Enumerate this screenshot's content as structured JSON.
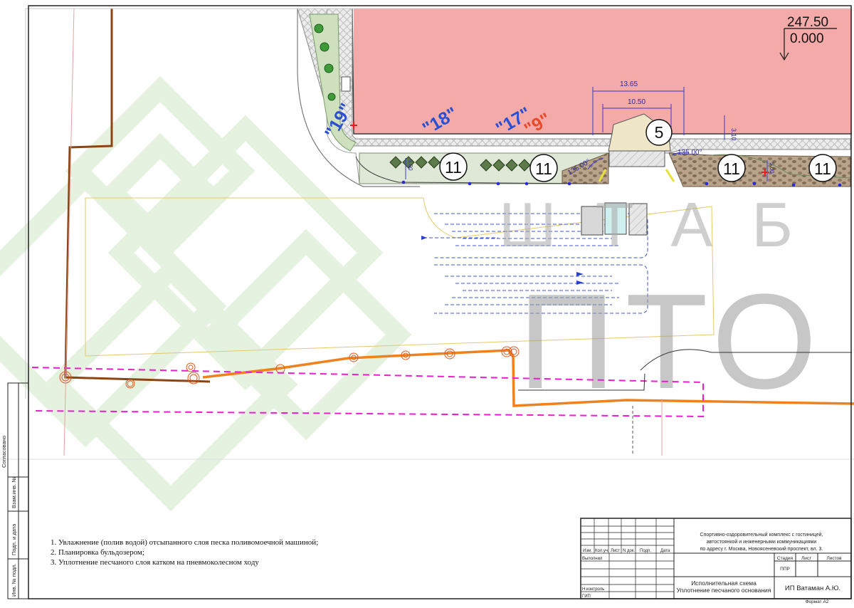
{
  "elevation": {
    "top": "247.50",
    "bottom": "0.000"
  },
  "dimensions": {
    "width_outer": "13.65",
    "width_inner": "10.50",
    "offset": "3.10",
    "angle_right": "135.00°",
    "angle_left": "135.00°",
    "small_a": "5.00",
    "small_b": "5.00"
  },
  "markers": {
    "m5": "5",
    "m11": "11"
  },
  "labels": {
    "l19": "\"19\"",
    "l18": "\"18\"",
    "l17": "\"17\"",
    "l9": "\"9\""
  },
  "watermark": {
    "row1": "ШТАБ",
    "row2": "ПТО"
  },
  "notes": [
    "1. Увлажнение (полив водой) отсыпанного слоя песка поливомоечной машиной;",
    "2. Планировка  бульдозером;",
    "3. Уплотнение песчаного слоя катком на пневмоколесном ходу"
  ],
  "side_stamp": [
    "Согласовано",
    "Взам.инв. №",
    "Подп. и дата",
    "Инв. № подл."
  ],
  "title_block": {
    "headers": [
      "Изм.",
      "Кол.уч.",
      "Лист",
      "N док.",
      "Подп.",
      "Дата"
    ],
    "row_names": [
      "Выполнил",
      "Н.контроль",
      "ГИП"
    ],
    "project": [
      "Спортивно-оздоровительный комплекс с гостиницей,",
      "автостоянкой и инженерными коммуникациями",
      "по адресу г. Москва, Новоясеневский проспект, вл. 3."
    ],
    "stage_headers": [
      "Стадия",
      "Лист",
      "Листов"
    ],
    "stage_value": "ППР",
    "doc_title": [
      "Исполнительная схема",
      "Уплотнение песчаного основания"
    ],
    "company": "ИП Ватаман А.Ю.",
    "format": "Формат А2"
  }
}
